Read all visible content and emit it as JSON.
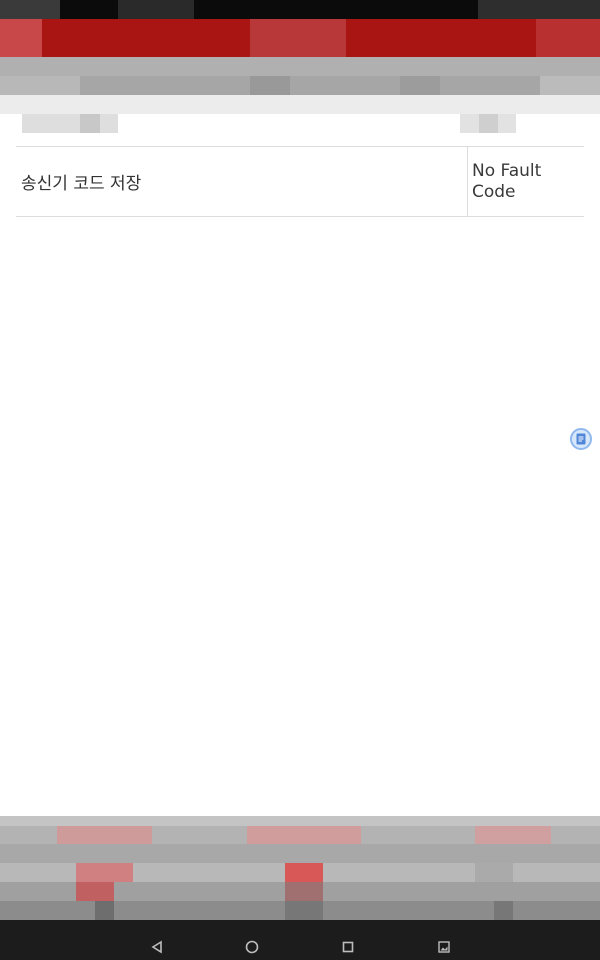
{
  "table": {
    "rows": [
      {
        "name": "송신기 코드 저장",
        "value": "No Fault\nCode"
      }
    ]
  },
  "icons": {
    "floating": "note-icon",
    "nav_back": "back-triangle-icon",
    "nav_home": "home-circle-icon",
    "nav_recent": "recent-apps-square-icon",
    "nav_screenshot": "screenshot-icon"
  },
  "colors": {
    "app_bar": "#a81512",
    "status_bar": "#0b0b0b",
    "nav_bar": "#1c1c1c",
    "accent_blue": "#4f86d8"
  }
}
